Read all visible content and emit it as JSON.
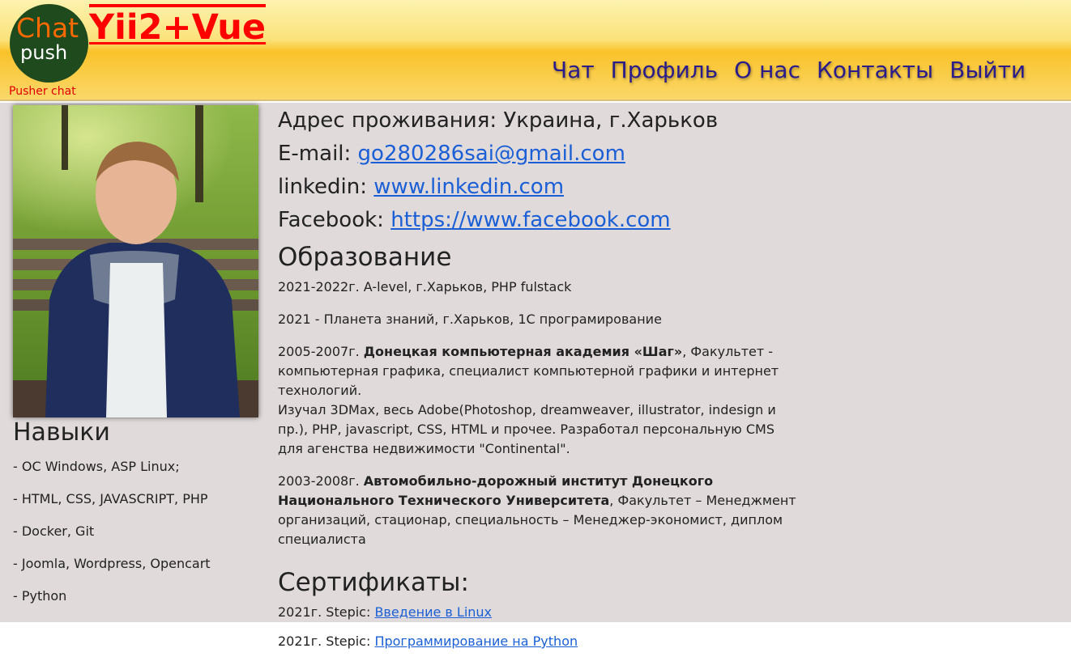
{
  "header": {
    "logo_chat": "Chat",
    "logo_push": "push",
    "logo_sub": "Pusher chat",
    "brand": "Yii2+Vue",
    "nav": [
      "Чат",
      "Профиль",
      "О нас",
      "Контакты",
      "Выйти"
    ]
  },
  "profile": {
    "photo_icon": "profile-photo",
    "address_label": "Адрес проживания: Украина, г.Харьков",
    "email_label": "E-mail: ",
    "email": "go280286sai@gmail.com",
    "linkedin_label": "linkedin: ",
    "linkedin": "www.linkedin.com",
    "facebook_label": "Facebook: ",
    "facebook": "https://www.facebook.com"
  },
  "skills": {
    "title": "Навыки",
    "items": [
      "- ОС Windows, ASP Linux;",
      "- HTML, CSS, JAVASCRIPT, PHP",
      "- Docker, Git",
      "- Joomla, Wordpress, Opencart",
      "- Python"
    ]
  },
  "education": {
    "title": "Образование",
    "items": [
      {
        "prefix": "2021-2022г. A-level, г.Харьков, PHP fulstack",
        "bold": "",
        "suffix": ""
      },
      {
        "prefix": "2021 - Планета знаний, г.Харьков, 1С програмирование",
        "bold": "",
        "suffix": ""
      },
      {
        "prefix": "2005-2007г. ",
        "bold": "Донецкая компьютерная академия «Шаг»",
        "suffix": ", Факультет - компьютерная графика, специалист компьютерной графики и интернет технологий.",
        "extra": "Изучал 3DMax, весь Adobe(Photoshop, dreamweaver, illustrator, indesign и пр.), PHP, javascript, CSS, HTML и прочее. Разработал персональную CMS для агенства недвижимости \"Continental\"."
      },
      {
        "prefix": "2003-2008г. ",
        "bold": "Автомобильно-дорожный институт Донецкого Национального Технического Университета",
        "suffix": ", Факультет – Менеджмент организаций, стационар, специальность – Менеджер-экономист, диплом специалиста"
      }
    ]
  },
  "certificates": {
    "title": "Сертификаты:",
    "items": [
      {
        "prefix": "2021г. Stepic: ",
        "link": "Введение в Linux"
      },
      {
        "prefix": "2021г. Stepic: ",
        "link": "Программирование на Python"
      }
    ]
  },
  "colors": {
    "link": "#1a5fd6",
    "nav": "#2a1c8a",
    "brand": "#ff0000",
    "content_bg": "#e0dada"
  }
}
